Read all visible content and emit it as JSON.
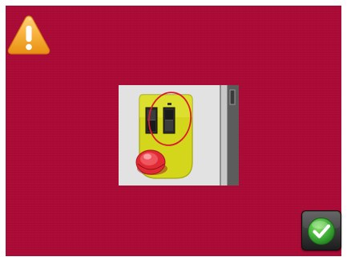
{
  "screen": {
    "background_color": "#aa0a36",
    "frame_color": "#ffffff"
  },
  "warning": {
    "icon": "warning-triangle-icon",
    "color": "#f5a623",
    "symbol": "!"
  },
  "instruction_image": {
    "subject": "emergency-stop-panel-with-switches-highlighted",
    "highlight_color": "#d81e2a",
    "button_color": "#e02b35",
    "panel_color": "#d6d81a"
  },
  "confirm": {
    "icon": "checkmark-icon",
    "color": "#38a83a"
  }
}
